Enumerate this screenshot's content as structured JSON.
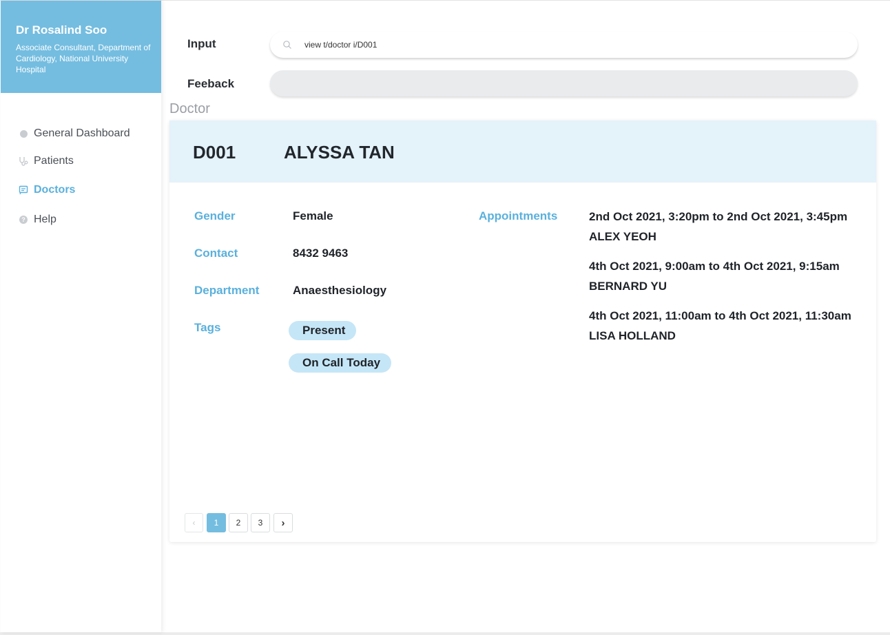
{
  "profile": {
    "name": "Dr Rosalind Soo",
    "role": "Associate Consultant, Department of Cardiology, National University Hospital"
  },
  "nav": {
    "items": [
      {
        "label": "General Dashboard",
        "icon": "dashboard-icon"
      },
      {
        "label": "Patients",
        "icon": "stethoscope-icon"
      },
      {
        "label": "Doctors",
        "icon": "doctor-list-icon",
        "active": true
      },
      {
        "label": "Help",
        "icon": "help-icon"
      }
    ]
  },
  "command": {
    "input_label": "Input",
    "input_value": "view t/doctor i/D001",
    "feedback_label": "Feeback",
    "feedback_text": ""
  },
  "section_title": "Doctor",
  "doctor": {
    "id": "D001",
    "name": "ALYSSA TAN",
    "labels": {
      "gender": "Gender",
      "contact": "Contact",
      "department": "Department",
      "tags": "Tags",
      "appointments": "Appointments"
    },
    "gender": "Female",
    "contact": "8432 9463",
    "department": "Anaesthesiology",
    "tags": [
      "Present",
      "On Call Today"
    ],
    "appointments": [
      {
        "time": "2nd Oct 2021, 3:20pm to  2nd Oct 2021, 3:45pm",
        "patient": "ALEX YEOH"
      },
      {
        "time": "4th Oct 2021, 9:00am to  4th Oct 2021, 9:15am",
        "patient": "BERNARD YU"
      },
      {
        "time": "4th Oct 2021, 11:00am to  4th Oct 2021, 11:30am",
        "patient": "LISA HOLLAND"
      }
    ]
  },
  "pagination": {
    "prev": "‹",
    "pages": [
      "1",
      "2",
      "3"
    ],
    "current_page": "1",
    "next": "›"
  },
  "colors": {
    "accent": "#74bde0",
    "accent_text": "#5ab0dc",
    "header_bg": "#e4f2fa",
    "tag_bg": "#c5e6f7"
  }
}
